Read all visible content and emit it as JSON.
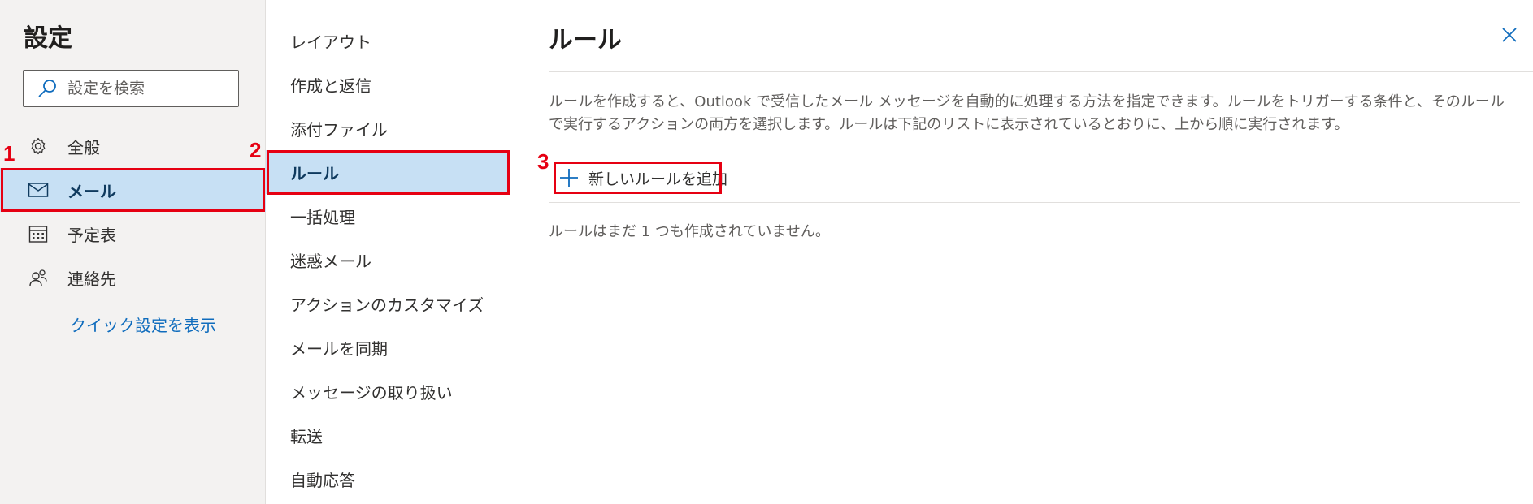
{
  "left_panel": {
    "title": "設定",
    "search_placeholder": "設定を検索",
    "items": [
      {
        "label": "全般",
        "icon": "gear-icon"
      },
      {
        "label": "メール",
        "icon": "mail-icon",
        "selected": true
      },
      {
        "label": "予定表",
        "icon": "calendar-icon"
      },
      {
        "label": "連絡先",
        "icon": "people-icon"
      }
    ],
    "quick_settings_link": "クイック設定を表示"
  },
  "middle_panel": {
    "items": [
      {
        "label": "レイアウト"
      },
      {
        "label": "作成と返信"
      },
      {
        "label": "添付ファイル"
      },
      {
        "label": "ルール",
        "selected": true
      },
      {
        "label": "一括処理"
      },
      {
        "label": "迷惑メール"
      },
      {
        "label": "アクションのカスタマイズ"
      },
      {
        "label": "メールを同期"
      },
      {
        "label": "メッセージの取り扱い"
      },
      {
        "label": "転送"
      },
      {
        "label": "自動応答"
      }
    ]
  },
  "content": {
    "title": "ルール",
    "description": "ルールを作成すると、Outlook で受信したメール メッセージを自動的に処理する方法を指定できます。ルールをトリガーする条件と、そのルールで実行するアクションの両方を選択します。ルールは下記のリストに表示されているとおりに、上から順に実行されます。",
    "add_rule_label": "新しいルールを追加",
    "empty_message": "ルールはまだ 1 つも作成されていません。"
  },
  "annotations": [
    {
      "number": "1"
    },
    {
      "number": "2"
    },
    {
      "number": "3"
    }
  ],
  "colors": {
    "selected_bg": "#c7e0f4",
    "accent": "#0f6cbd",
    "annotation_red": "#e60012",
    "left_bg": "#f3f2f1"
  }
}
